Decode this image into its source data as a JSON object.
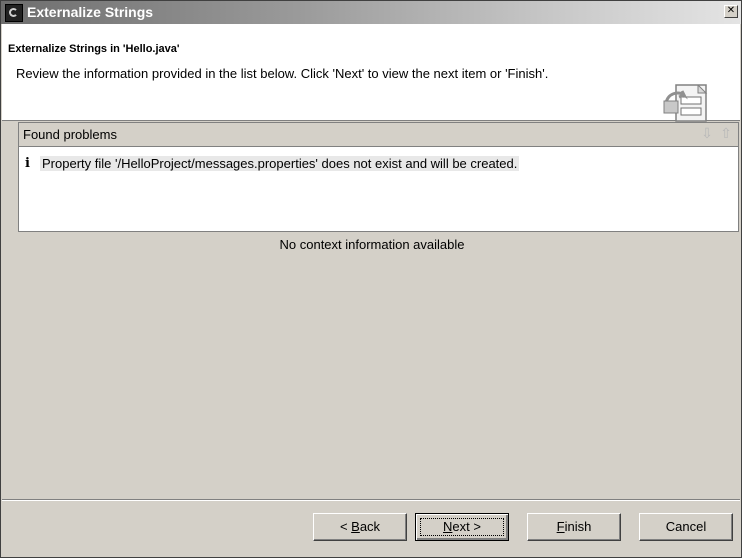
{
  "window": {
    "title": "Externalize Strings",
    "close_symbol": "✕"
  },
  "header": {
    "title": "Externalize Strings in 'Hello.java'",
    "description": "Review the information provided in the list below. Click 'Next' to view the next item or 'Finish'."
  },
  "problems": {
    "title": "Found problems",
    "items": [
      {
        "icon": "info-icon",
        "text": "Property file '/HelloProject/messages.properties' does not exist and will be created."
      }
    ]
  },
  "context": {
    "text": "No context information available"
  },
  "buttons": {
    "back": {
      "prefix": "< ",
      "mnemonic": "B",
      "rest": "ack"
    },
    "next": {
      "mnemonic": "N",
      "rest": "ext >"
    },
    "finish": {
      "mnemonic": "F",
      "rest": "inish"
    },
    "cancel": "Cancel"
  }
}
